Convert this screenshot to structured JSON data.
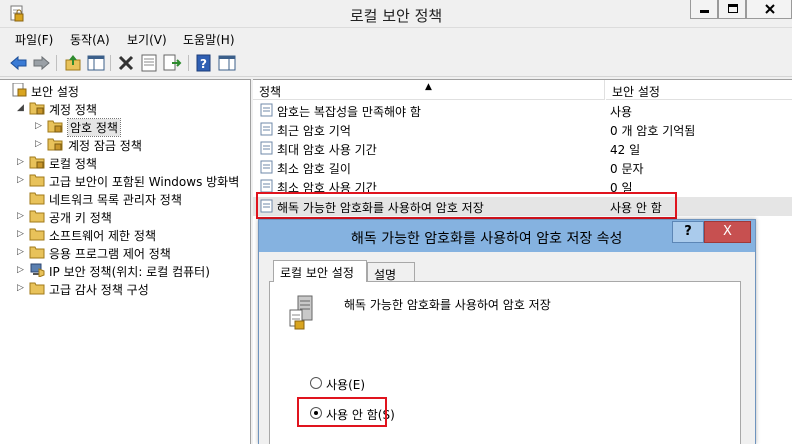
{
  "window": {
    "title": "로컬 보안 정책"
  },
  "menu": [
    "파일(F)",
    "동작(A)",
    "보기(V)",
    "도움말(H)"
  ],
  "toolbar": {
    "icons": [
      "back-icon",
      "forward-icon",
      "up-folder-icon",
      "show-hide-tree-icon",
      "delete-icon",
      "properties-icon",
      "export-icon",
      "help-icon",
      "action-pane-icon"
    ]
  },
  "tree": {
    "root": "보안 설정",
    "account_policies": "계정 정책",
    "password_policy": "암호 정책",
    "lockout_policy": "계정 잠금 정책",
    "local_policies": "로컬 정책",
    "firewall": "고급 보안이 포함된 Windows 방화벽",
    "network_list": "네트워크 목록 관리자 정책",
    "public_key": "공개 키 정책",
    "software_restriction": "소프트웨어 제한 정책",
    "app_control": "응용 프로그램 제어 정책",
    "ip_security": "IP 보안 정책(위치: 로컬 컴퓨터)",
    "advanced_audit": "고급 감사 정책 구성"
  },
  "list": {
    "col_policy": "정책",
    "col_setting": "보안 설정",
    "rows": [
      {
        "name": "암호는 복잡성을 만족해야 함",
        "value": "사용"
      },
      {
        "name": "최근 암호 기억",
        "value": "0 개 암호 기억됨"
      },
      {
        "name": "최대 암호 사용 기간",
        "value": "42 일"
      },
      {
        "name": "최소 암호 길이",
        "value": "0 문자"
      },
      {
        "name": "최소 암호 사용 기간",
        "value": "0 일"
      },
      {
        "name": "해독 가능한 암호화를 사용하여 암호 저장",
        "value": "사용 안 함"
      }
    ]
  },
  "dialog": {
    "title": "해독 가능한 암호화를 사용하여 암호 저장 속성",
    "help": "?",
    "close": "X",
    "tabs": [
      "로컬 보안 설정",
      "설명"
    ],
    "description": "해독 가능한 암호화를 사용하여 암호 저장",
    "options": [
      "사용(E)",
      "사용 안 함(S)"
    ],
    "selected_option": 1
  },
  "colors": {
    "dialog_title": "#85b2e0",
    "highlight_box": "#e0141e",
    "close_button": "#c75050"
  }
}
